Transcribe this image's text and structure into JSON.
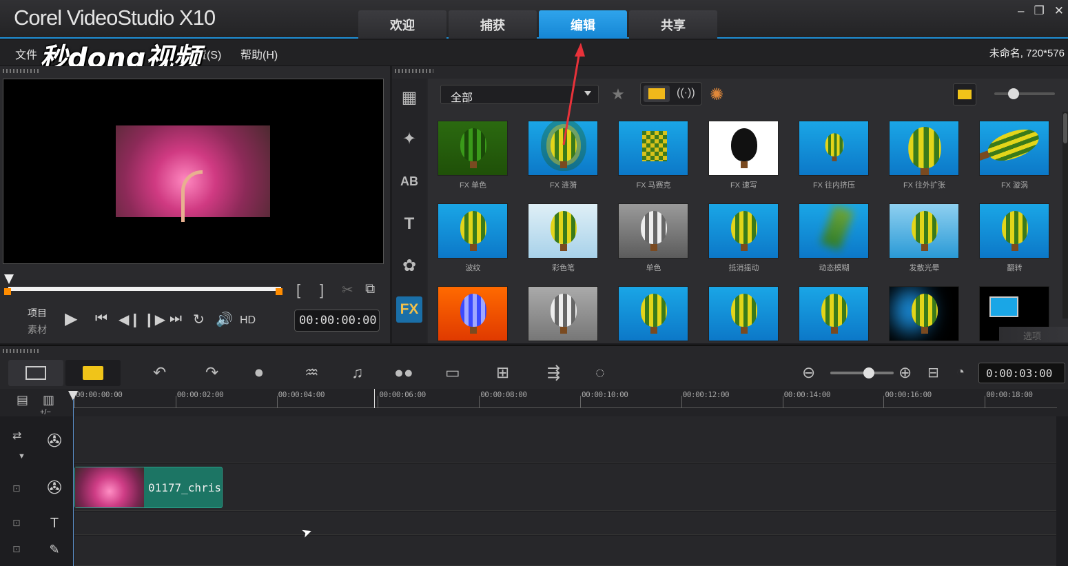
{
  "app": {
    "title": "Corel VideoStudio X10",
    "project_info": "未命名, 720*576",
    "window_controls": [
      "–",
      "❐",
      "✕"
    ]
  },
  "tabs": [
    {
      "label": "欢迎"
    },
    {
      "label": "捕获"
    },
    {
      "label": "编辑"
    },
    {
      "label": "共享"
    }
  ],
  "active_tab": "编辑",
  "menu": {
    "file": "文件",
    "settings_suffix": "置(S)",
    "help": "帮助(H)"
  },
  "watermark": "秒dong视频",
  "player": {
    "mode_project": "项目",
    "mode_clip": "素材",
    "timecode": "00:00:00:00",
    "hd_label": "HD",
    "bracket_in": "[",
    "bracket_out": "]"
  },
  "library": {
    "category": "全部",
    "options_label": "选项",
    "fx_tab": "FX",
    "items": [
      {
        "label": "FX 单色",
        "style": "green"
      },
      {
        "label": "FX 涟漪",
        "style": "ripple"
      },
      {
        "label": "FX 马赛克",
        "style": "mosaic"
      },
      {
        "label": "FX 速写",
        "style": "sketch"
      },
      {
        "label": "FX 往内挤压",
        "style": "balloon-small"
      },
      {
        "label": "FX 往外扩张",
        "style": "balloon-big"
      },
      {
        "label": "FX 漩涡",
        "style": "swirl"
      },
      {
        "label": "波纹",
        "style": "balloon"
      },
      {
        "label": "彩色笔",
        "style": "pale"
      },
      {
        "label": "单色",
        "style": "gray"
      },
      {
        "label": "抵消摇动",
        "style": "balloon"
      },
      {
        "label": "动态模糊",
        "style": "blur"
      },
      {
        "label": "发散光晕",
        "style": "glow"
      },
      {
        "label": "翻转",
        "style": "balloon"
      },
      {
        "label": "",
        "style": "orange"
      },
      {
        "label": "",
        "style": "grayballoon"
      },
      {
        "label": "",
        "style": "balloon"
      },
      {
        "label": "",
        "style": "balloon"
      },
      {
        "label": "",
        "style": "balloon"
      },
      {
        "label": "",
        "style": "dark"
      },
      {
        "label": "",
        "style": "darksmall"
      }
    ]
  },
  "timeline": {
    "duration": "0:00:03:00",
    "track_add": "+/−",
    "ruler": [
      "00:00:00:00",
      "00:00:02:00",
      "00:00:04:00",
      "00:00:06:00",
      "00:00:08:00",
      "00:00:10:00",
      "00:00:12:00",
      "00:00:14:00",
      "00:00:16:00",
      "00:00:18:00"
    ],
    "clip_name": "01177_chris"
  },
  "colors": {
    "accent": "#1e8fd6",
    "annotation": "#e8323a",
    "clip": "#1c7564"
  }
}
